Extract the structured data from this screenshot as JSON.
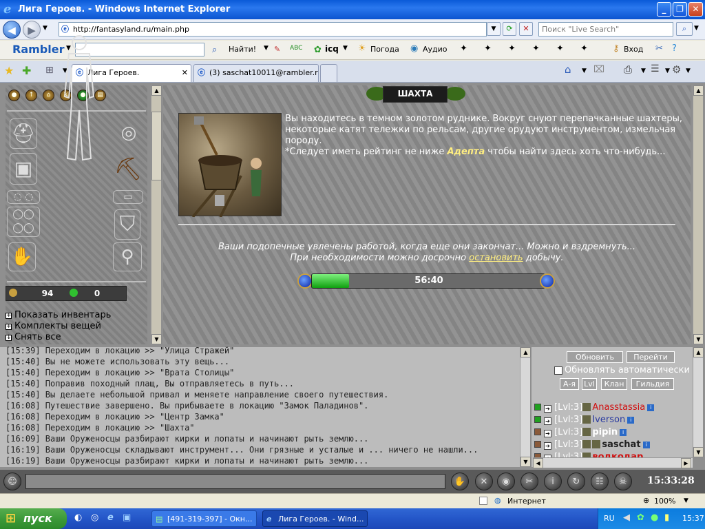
{
  "window": {
    "title": "Лига Героев. - Windows Internet Explorer"
  },
  "address": {
    "url": "http://fantasyland.ru/main.php",
    "search_placeholder": "Поиск \"Live Search\""
  },
  "rambler": {
    "logo": "Rambler",
    "find": "Найти!",
    "weather": "Погода",
    "audio": "Аудио",
    "login": "Вход"
  },
  "tabs": [
    {
      "label": "Лига Героев."
    },
    {
      "label": "(3) saschat10011@rambler.ru"
    }
  ],
  "left": {
    "stat1": "94",
    "stat2": "0",
    "links": [
      "Показать инвентарь",
      "Комплекты вещей",
      "Снять все"
    ]
  },
  "main": {
    "location": "ШАХТА",
    "desc_text": "Вы находитесь в темном золотом руднике. Вокруг снуют перепачканные шахтеры, некоторые катят тележки по рельсам, другие орудуют инструментом, измельчая породу.",
    "req_prefix": "*Следует иметь рейтинг не ниже ",
    "req_rank": "Адепта",
    "req_suffix": " чтобы найти здесь хоть что-нибудь...",
    "msg1": "Ваши подопечные увлечены работой, когда еще они закончат... Можно и вздремнуть...",
    "msg2_prefix": "При необходимости можно досрочно ",
    "msg2_link": "остановить",
    "msg2_suffix": " добычу.",
    "timer": "56:40",
    "progress": 0.16
  },
  "log": [
    "[15:39] Переходим в локацию >> \"Улица Стражей\"",
    "[15:40] Вы не можете использовать эту вещь...",
    "[15:40] Переходим в локацию >> \"Врата Столицы\"",
    "[15:40] Поправив походный плащ, Вы отправляетесь в путь...",
    "[15:40] Вы делаете небольшой привал и меняете направление своего путешествия.",
    "[16:08] Путешествие завершено. Вы прибываете в локацию \"Замок Паладинов\".",
    "[16:08] Переходим в локацию >> \"Центр Замка\"",
    "[16:08] Переходим в локацию >> \"Шахта\"",
    "[16:09] Ваши Оруженосцы разбирают кирки и лопаты и начинают рыть землю...",
    "[16:19] Ваши Оруженосцы складывают инструмент... Они грязные и усталые и ... ничего не нашли...",
    "[16:19] Ваши Оруженосцы разбирают кирки и лопаты и начинают рыть землю..."
  ],
  "players_panel": {
    "refresh": "Обновить",
    "goto": "Перейти",
    "auto_refresh": "Обновлять автоматически",
    "sort_az": "А-я",
    "sort_lvl": "Lvl",
    "sort_clan": "Клан",
    "sort_guild": "Гильдия",
    "players": [
      {
        "lvl": "[Lvl:3]",
        "name": "Anasstassia",
        "color": "#d01010",
        "status": "#20a020"
      },
      {
        "lvl": "[Lvl:3]",
        "name": "Iverson",
        "color": "#2a3aa0",
        "status": "#20a020"
      },
      {
        "lvl": "[Lvl:3]",
        "name": "pipin",
        "color": "#ffffff",
        "status": "#8a5a3a"
      },
      {
        "lvl": "[Lvl:3]",
        "name": "saschat",
        "color": "#222222",
        "status": "#8a5a3a"
      },
      {
        "lvl": "[Lvl:3]",
        "name": "водкодар",
        "color": "#d01010",
        "status": "#8a5a3a"
      }
    ]
  },
  "bottom": {
    "clock": "15:33:28"
  },
  "status": {
    "zone": "Интернет",
    "zoom": "100%"
  },
  "taskbar": {
    "start": "пуск",
    "tasks": [
      "[491-319-397] - Окн...",
      "Лига Героев. - Wind..."
    ],
    "lang": "RU",
    "time": "15:37"
  }
}
